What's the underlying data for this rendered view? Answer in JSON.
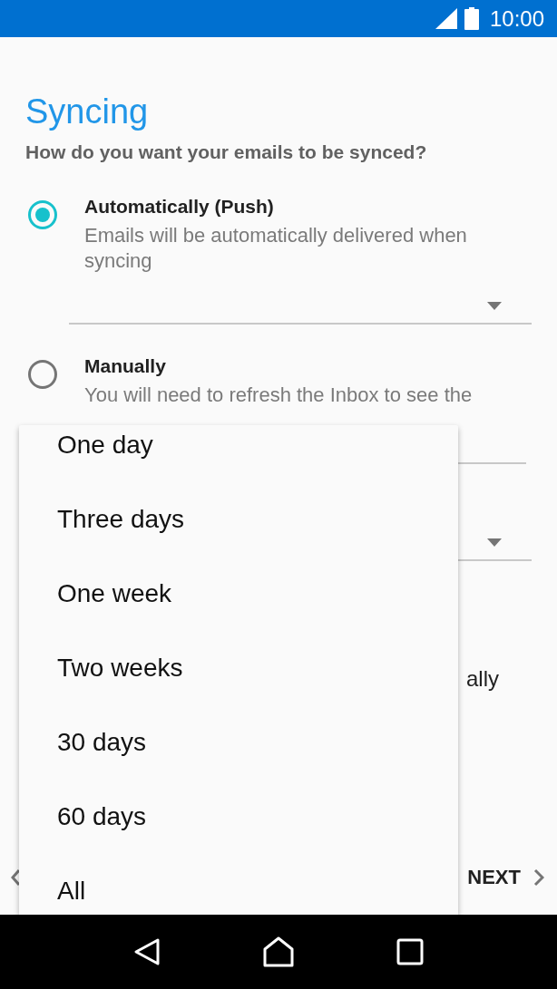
{
  "status_bar": {
    "time": "10:00"
  },
  "title": "Syncing",
  "question": "How do you want your emails to be synced?",
  "options": [
    {
      "label": "Automatically (Push)",
      "description": "Emails will be automatically delivered when syncing",
      "selected": true
    },
    {
      "label": "Manually",
      "description": "You will need to refresh the Inbox to see the",
      "selected": false
    }
  ],
  "covered_label_fragment": "ally",
  "footer": {
    "next_label": "NEXT"
  },
  "dropdown_menu": {
    "items": [
      "One day",
      "Three days",
      "One week",
      "Two weeks",
      "30 days",
      "60 days",
      "All"
    ]
  }
}
